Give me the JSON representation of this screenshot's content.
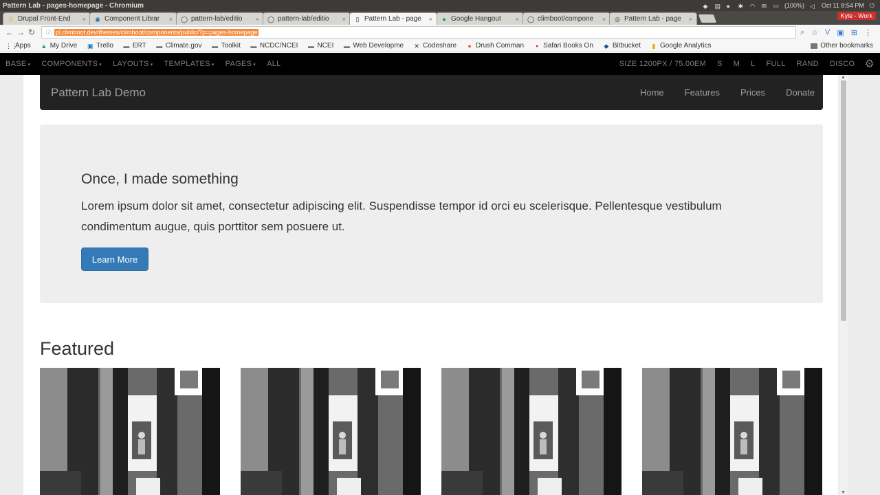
{
  "os": {
    "window_title": "Pattern Lab - pages-homepage - Chromium",
    "battery": "(100%)",
    "clock": "Oct 11 8:54 PM",
    "user": "Kyle - Work"
  },
  "tabs": [
    {
      "label": "Drupal Front-End",
      "icon": "google-icon"
    },
    {
      "label": "Component Librar",
      "icon": "globe-icon"
    },
    {
      "label": "pattern-lab/editio",
      "icon": "github-icon"
    },
    {
      "label": "pattern-lab/editio",
      "icon": "github-icon"
    },
    {
      "label": "Pattern Lab - page",
      "icon": "document-icon",
      "active": true
    },
    {
      "label": "Google Hangout",
      "icon": "hangouts-icon"
    },
    {
      "label": "climboot/compone",
      "icon": "github-icon"
    },
    {
      "label": "Pattern Lab - page",
      "icon": "patternlab-icon"
    }
  ],
  "address": {
    "url": "pl.climboot.dev/themes/climboot/components/public/?p=pages-homepage"
  },
  "bookmarks": [
    {
      "label": "Apps",
      "icon": "apps-grid-icon"
    },
    {
      "label": "My Drive",
      "icon": "drive-icon"
    },
    {
      "label": "Trello",
      "icon": "trello-icon"
    },
    {
      "label": "ERT",
      "icon": "folder-icon"
    },
    {
      "label": "Climate.gov",
      "icon": "folder-icon"
    },
    {
      "label": "Toolkit",
      "icon": "folder-icon"
    },
    {
      "label": "NCDC/NCEI",
      "icon": "folder-icon"
    },
    {
      "label": "NCEI",
      "icon": "folder-icon"
    },
    {
      "label": "Web Developme",
      "icon": "folder-icon"
    },
    {
      "label": "Codeshare",
      "icon": "codeshare-icon"
    },
    {
      "label": "Drush Comman",
      "icon": "drush-icon"
    },
    {
      "label": "Safari Books On",
      "icon": "safari-books-icon"
    },
    {
      "label": "Bitbucket",
      "icon": "bitbucket-icon"
    },
    {
      "label": "Google Analytics",
      "icon": "analytics-icon"
    }
  ],
  "other_bookmarks": "Other bookmarks",
  "patternlab": {
    "menu": [
      "BASE",
      "COMPONENTS",
      "LAYOUTS",
      "TEMPLATES",
      "PAGES",
      "ALL"
    ],
    "size_label": "SIZE 1200PX / 75.00EM",
    "controls": [
      "S",
      "M",
      "L",
      "FULL",
      "RAND",
      "DISCO"
    ]
  },
  "site": {
    "brand": "Pattern Lab Demo",
    "nav": [
      "Home",
      "Features",
      "Prices",
      "Donate"
    ],
    "hero_title": "Once, I made something",
    "hero_text": "Lorem ipsum dolor sit amet, consectetur adipiscing elit. Suspendisse tempor id orci eu scelerisque. Pellentesque vestibulum condimentum augue, quis porttitor sem posuere ut.",
    "hero_button": "Learn More",
    "featured_heading": "Featured"
  },
  "colors": {
    "primary_button": "#337ab7",
    "navbar": "#222222",
    "jumbotron": "#eeeeee"
  }
}
